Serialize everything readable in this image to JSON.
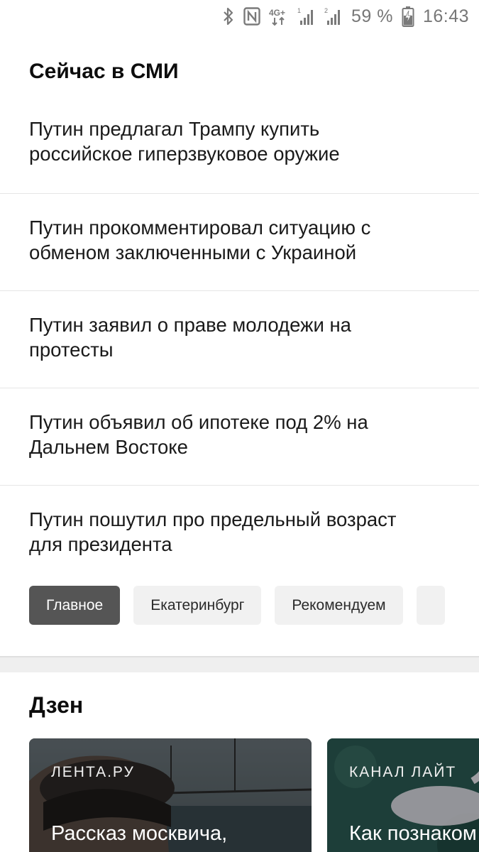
{
  "status_bar": {
    "battery_percent": "59 %",
    "time": "16:43",
    "icons": [
      "bluetooth-icon",
      "nfc-icon",
      "network-4g-icon",
      "signal-sim1-icon",
      "signal-sim2-icon",
      "battery-icon"
    ]
  },
  "news": {
    "title": "Сейчас в СМИ",
    "items": [
      {
        "line1": "Путин предлагал Трампу купить",
        "line2": "российское гиперзвуковое оружие"
      },
      {
        "line1": "Путин прокомментировал ситуацию с",
        "line2": "обменом заключенными с Украиной"
      },
      {
        "line1": "Путин заявил о праве молодежи на",
        "line2": "протесты"
      },
      {
        "line1": "Путин объявил об ипотеке под 2% на",
        "line2": "Дальнем Востоке"
      },
      {
        "line1": "Путин пошутил про предельный возраст",
        "line2": "для президента"
      }
    ],
    "chips": [
      "Главное",
      "Екатеринбург",
      "Рекомендуем"
    ],
    "active_chip": "Главное"
  },
  "zen": {
    "title": "Дзен",
    "cards": [
      {
        "source": "ЛЕНТА.РУ",
        "headline": "Рассказ москвича,"
      },
      {
        "source": "КАНАЛ ЛАЙТ",
        "headline": "Как познаком"
      }
    ]
  },
  "colors": {
    "active_chip_bg": "#555555",
    "chip_bg": "#f1f1f1",
    "separator": "#efefef"
  }
}
